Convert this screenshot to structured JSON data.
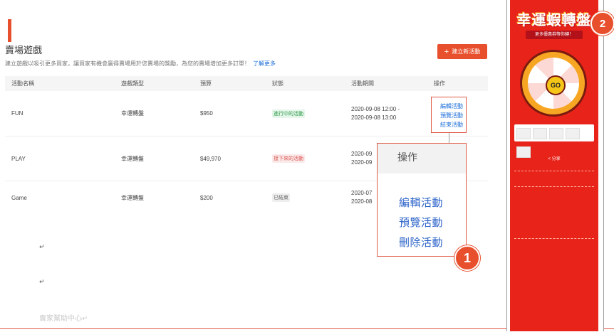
{
  "header": {
    "title": "賣場遊戲",
    "description": "建立遊戲以吸引更多買家，讓買家有機會贏得賣場用於您賣場的獎勵，為您的賣場增加更多訂單！",
    "learn_more": "了解更多",
    "create_button": "建立新活動",
    "create_icon": "plus-icon"
  },
  "table": {
    "columns": [
      "活動名稱",
      "遊戲類型",
      "預算",
      "狀態",
      "活動期間",
      "操作"
    ],
    "rows": [
      {
        "name": "FUN",
        "type": "幸運轉盤",
        "budget": "$950",
        "status": "進行中的活動",
        "period_start": "2020-09-08 12:00 -",
        "period_end": "2020-09-08 13:00"
      },
      {
        "name": "PLAY",
        "type": "幸運轉盤",
        "budget": "$49,970",
        "status": "接下來的活動",
        "period_start": "2020-09",
        "period_end": "2020-09"
      },
      {
        "name": "Game",
        "type": "幸運轉盤",
        "budget": "$200",
        "status": "已結束",
        "period_start": "2020-07",
        "period_end": "2020-08"
      }
    ],
    "ops_small": [
      "編輯活動",
      "預覽活動",
      "結束活動"
    ]
  },
  "zoom": {
    "header": "操作",
    "ops": [
      "編輯活動",
      "預覽活動",
      "刪除活動"
    ]
  },
  "badges": {
    "one": "1",
    "two": "2"
  },
  "doc": {
    "para_mark": "↵",
    "faded_text": "賣家幫助中心↵"
  },
  "phone": {
    "promo_title": "幸運蝦轉盤",
    "promo_subtitle": "更多優惠券等你轉！",
    "go_label": "GO",
    "share_label": "< 分享"
  },
  "colors": {
    "accent": "#e8502d",
    "link": "#1e6fd9",
    "phone_bg": "#e8231a"
  }
}
